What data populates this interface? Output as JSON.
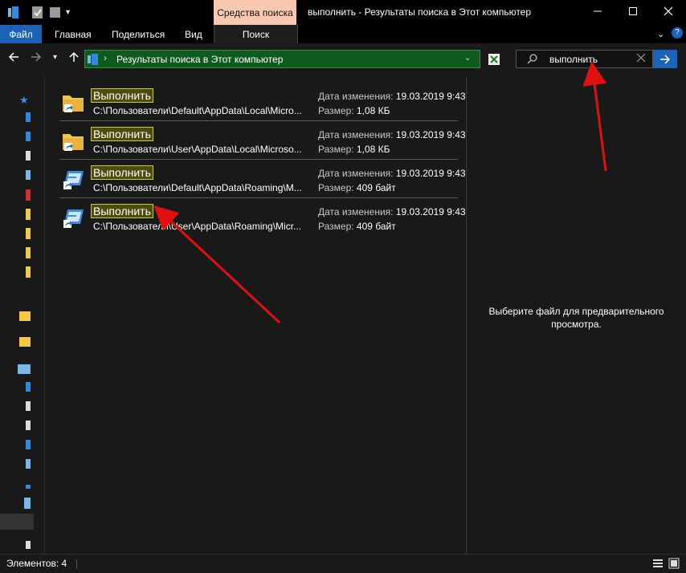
{
  "titlebar": {
    "title": "выполнить - Результаты поиска в Этот компьютер",
    "context_tab": "Средства поиска"
  },
  "ribbon": {
    "tabs": [
      "Файл",
      "Главная",
      "Поделиться",
      "Вид"
    ],
    "context_tab": "Поиск"
  },
  "address": {
    "breadcrumb": "Результаты поиска в Этот компьютер"
  },
  "search": {
    "value": "выполнить"
  },
  "results": [
    {
      "name": "Выполнить",
      "path": "C:\\Пользователи\\Default\\AppData\\Local\\Micro...",
      "date_label": "Дата изменения:",
      "date": "19.03.2019 9:43",
      "size_label": "Размер:",
      "size": "1,08 КБ",
      "icon": "folder-shortcut-icon"
    },
    {
      "name": "Выполнить",
      "path": "C:\\Пользователи\\User\\AppData\\Local\\Microso...",
      "date_label": "Дата изменения:",
      "date": "19.03.2019 9:43",
      "size_label": "Размер:",
      "size": "1,08 КБ",
      "icon": "folder-shortcut-icon"
    },
    {
      "name": "Выполнить",
      "path": "C:\\Пользователи\\Default\\AppData\\Roaming\\M...",
      "date_label": "Дата изменения:",
      "date": "19.03.2019 9:43",
      "size_label": "Размер:",
      "size": "409 байт",
      "icon": "run-shortcut-icon"
    },
    {
      "name": "Выполнить",
      "path": "C:\\Пользователи\\User\\AppData\\Roaming\\Micr...",
      "date_label": "Дата изменения:",
      "date": "19.03.2019 9:43",
      "size_label": "Размер:",
      "size": "409 байт",
      "icon": "run-shortcut-icon"
    }
  ],
  "preview": {
    "message_line1": "Выберите файл для предварительного",
    "message_line2": "просмотра."
  },
  "status": {
    "items_text": "Элементов: 4"
  },
  "colors": {
    "accent": "#1a63b8",
    "context_tab_bg": "#f8c9b0",
    "address_bg": "#0f5a1e",
    "highlight_bg": "#4d4d0e",
    "highlight_border": "#c8c84a",
    "annotation_arrow": "#e01010"
  }
}
